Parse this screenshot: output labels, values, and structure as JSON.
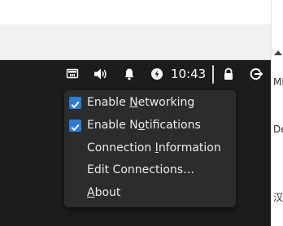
{
  "tray": {
    "icons": [
      "network-icon",
      "volume-icon",
      "bell-icon",
      "power-icon",
      "lock-icon",
      "logout-icon"
    ],
    "clock": "10:43"
  },
  "menu": {
    "items": [
      {
        "pre": "Enable ",
        "mn": "N",
        "post": "etworking",
        "checked": true
      },
      {
        "pre": "Enable N",
        "mn": "o",
        "post": "tifications",
        "checked": true
      },
      {
        "pre": "Connection ",
        "mn": "I",
        "post": "nformation",
        "checked": false
      },
      {
        "pre": "Edit Connections…",
        "mn": "",
        "post": "",
        "checked": false
      },
      {
        "pre": "",
        "mn": "A",
        "post": "bout",
        "checked": false
      }
    ]
  },
  "right_fragments": [
    "MI",
    "De",
    "汉"
  ],
  "colors": {
    "checkbox": "#2f7bd3",
    "menu_bg": "#2b2c2e",
    "panel_bg": "#1b1c1e"
  }
}
